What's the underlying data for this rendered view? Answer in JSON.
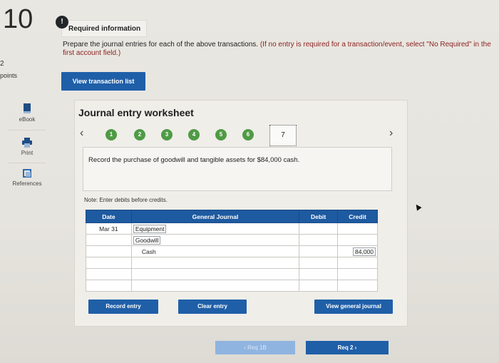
{
  "question": {
    "number": "10",
    "points_value": "2",
    "points_label": "points"
  },
  "rail": {
    "ebook": "eBook",
    "print": "Print",
    "references": "References"
  },
  "info": {
    "badge": "!",
    "title": "Required information",
    "prompt_main": "Prepare the journal entries for each of the above transactions.",
    "prompt_hint": "(If no entry is required for a transaction/event, select \"No Required\" in the first account field.)"
  },
  "buttons": {
    "view_transaction_list": "View transaction list",
    "record_entry": "Record entry",
    "clear_entry": "Clear entry",
    "view_general_journal": "View general journal"
  },
  "worksheet": {
    "title": "Journal entry worksheet",
    "nav_prev": "‹",
    "nav_next": "›",
    "steps": [
      "1",
      "2",
      "3",
      "4",
      "5",
      "6",
      "7"
    ],
    "current_step": "7",
    "description": "Record the purchase of goodwill and tangible assets for $84,000 cash.",
    "note": "Note: Enter debits before credits."
  },
  "journal": {
    "headers": {
      "date": "Date",
      "account": "General Journal",
      "debit": "Debit",
      "credit": "Credit"
    },
    "rows": [
      {
        "date": "Mar 31",
        "account": "Equipment",
        "debit": "",
        "credit": ""
      },
      {
        "date": "",
        "account": "Goodwill",
        "debit": "",
        "credit": ""
      },
      {
        "date": "",
        "account": "Cash",
        "debit": "",
        "credit": "84,000"
      },
      {
        "date": "",
        "account": "",
        "debit": "",
        "credit": ""
      },
      {
        "date": "",
        "account": "",
        "debit": "",
        "credit": ""
      },
      {
        "date": "",
        "account": "",
        "debit": "",
        "credit": ""
      }
    ]
  },
  "requirements": {
    "prev_label": "‹  Req 1B",
    "next_label": "Req 2  ›"
  },
  "colors": {
    "primary_blue": "#1f5fa8",
    "step_green": "#4f9b45",
    "header_blue": "#1e5aa0"
  }
}
